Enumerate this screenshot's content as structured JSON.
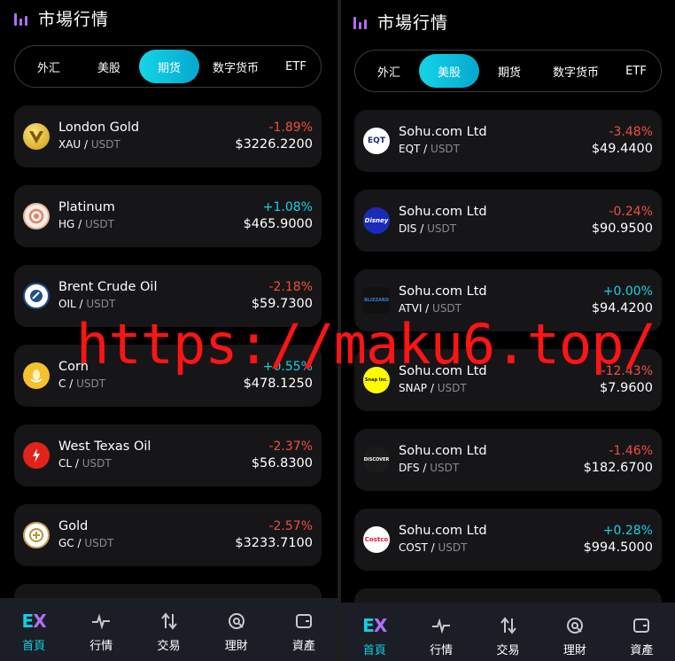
{
  "watermark": "https://maku6.top/",
  "left": {
    "header": {
      "title": "市場行情",
      "icon": "bar-chart-icon"
    },
    "tabs": [
      "外汇",
      "美股",
      "期货",
      "数字货币",
      "ETF"
    ],
    "active_tab": "期货",
    "items": [
      {
        "name": "London Gold",
        "base": "XAU",
        "quote": "USDT",
        "change": "-1.89%",
        "price": "$3226.2200",
        "dir": "down",
        "logo": "london-gold-logo"
      },
      {
        "name": "Platinum",
        "base": "HG",
        "quote": "USDT",
        "change": "+1.08%",
        "price": "$465.9000",
        "dir": "up",
        "logo": "platinum-logo"
      },
      {
        "name": "Brent Crude Oil",
        "base": "OIL",
        "quote": "USDT",
        "change": "-2.18%",
        "price": "$59.7300",
        "dir": "down",
        "logo": "brent-logo"
      },
      {
        "name": "Corn",
        "base": "C",
        "quote": "USDT",
        "change": "+0.55%",
        "price": "$478.1250",
        "dir": "up",
        "logo": "corn-logo"
      },
      {
        "name": "West Texas Oil",
        "base": "CL",
        "quote": "USDT",
        "change": "-2.37%",
        "price": "$56.8300",
        "dir": "down",
        "logo": "wti-logo"
      },
      {
        "name": "Gold",
        "base": "GC",
        "quote": "USDT",
        "change": "-2.57%",
        "price": "$3233.7100",
        "dir": "down",
        "logo": "gold-logo"
      }
    ],
    "nav": [
      {
        "label": "首頁",
        "icon": "ex-logo-icon"
      },
      {
        "label": "行情",
        "icon": "pulse-icon"
      },
      {
        "label": "交易",
        "icon": "swap-arrows-icon"
      },
      {
        "label": "理財",
        "icon": "finance-icon"
      },
      {
        "label": "資產",
        "icon": "wallet-icon"
      }
    ]
  },
  "right": {
    "header": {
      "title": "市場行情",
      "icon": "bar-chart-icon"
    },
    "tabs": [
      "外汇",
      "美股",
      "期货",
      "数字货币",
      "ETF"
    ],
    "active_tab": "美股",
    "items": [
      {
        "name": "Sohu.com Ltd",
        "base": "EQT",
        "quote": "USDT",
        "change": "-3.48%",
        "price": "$49.4400",
        "dir": "down",
        "logo": "eqt-logo",
        "logo_text": "EQT"
      },
      {
        "name": "Sohu.com Ltd",
        "base": "DIS",
        "quote": "USDT",
        "change": "-0.24%",
        "price": "$90.9500",
        "dir": "down",
        "logo": "disney-logo",
        "logo_text": "Disney"
      },
      {
        "name": "Sohu.com Ltd",
        "base": "ATVI",
        "quote": "USDT",
        "change": "+0.00%",
        "price": "$94.4200",
        "dir": "up",
        "logo": "activision-logo",
        "logo_text": "BLIZZARD"
      },
      {
        "name": "Sohu.com Ltd",
        "base": "SNAP",
        "quote": "USDT",
        "change": "-12.43%",
        "price": "$7.9600",
        "dir": "down",
        "logo": "snap-logo",
        "logo_text": "Snap Inc."
      },
      {
        "name": "Sohu.com Ltd",
        "base": "DFS",
        "quote": "USDT",
        "change": "-1.46%",
        "price": "$182.6700",
        "dir": "down",
        "logo": "discover-logo",
        "logo_text": "DISCOVER"
      },
      {
        "name": "Sohu.com Ltd",
        "base": "COST",
        "quote": "USDT",
        "change": "+0.28%",
        "price": "$994.5000",
        "dir": "up",
        "logo": "costco-logo",
        "logo_text": "Costco"
      }
    ],
    "nav": [
      {
        "label": "首頁",
        "icon": "ex-logo-icon"
      },
      {
        "label": "行情",
        "icon": "pulse-icon"
      },
      {
        "label": "交易",
        "icon": "swap-arrows-icon"
      },
      {
        "label": "理財",
        "icon": "finance-icon"
      },
      {
        "label": "資產",
        "icon": "wallet-icon"
      }
    ]
  },
  "colors": {
    "accent": "#12cfe3",
    "down": "#f0503c",
    "up": "#18d1e3",
    "card": "#161619",
    "brand_purple": "#b06ef5"
  }
}
